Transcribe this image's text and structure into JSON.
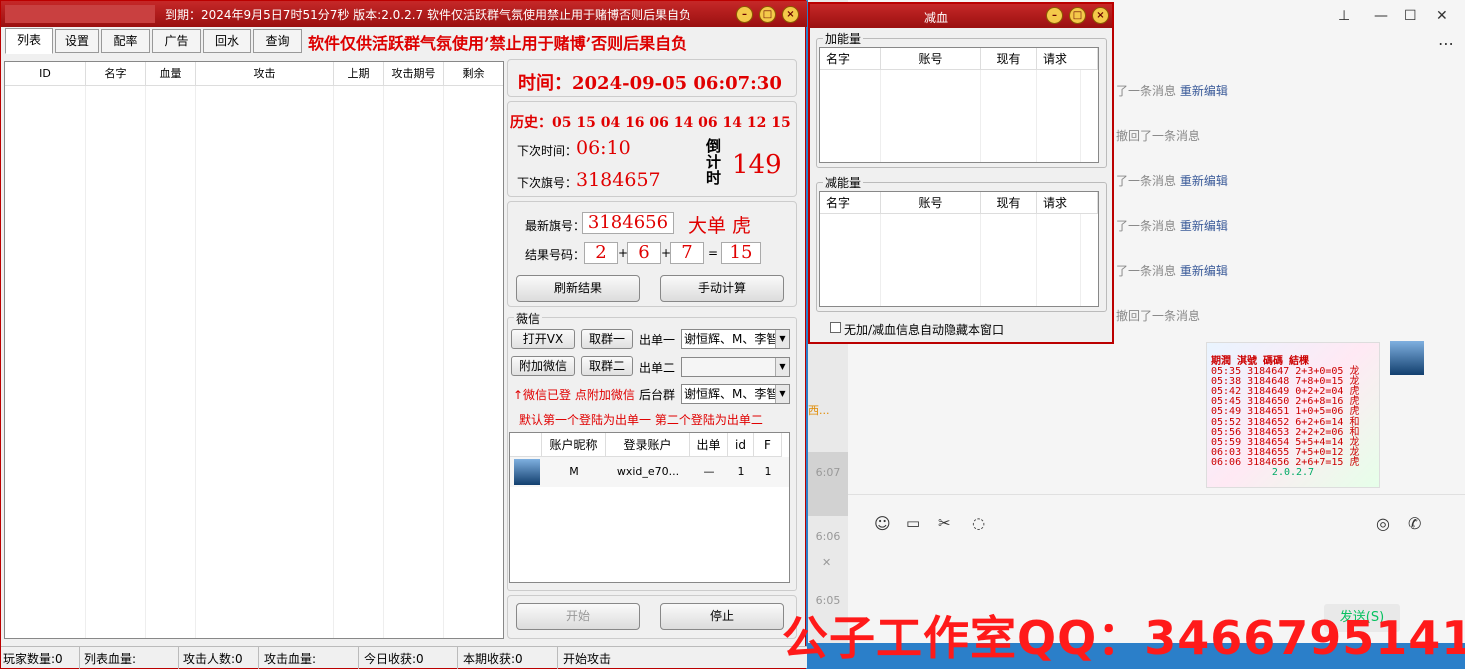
{
  "main": {
    "title": "到期：2024年9月5日7时51分7秒 版本:2.0.2.7 软件仅活跃群气氛使用禁止用于赌博否则后果自负",
    "tabs": [
      "列表",
      "设置",
      "配率",
      "广告",
      "回水",
      "查询"
    ],
    "warning": "软件仅供活跃群气氛使用’禁止用于赌博’否则后果自负",
    "list_columns": [
      "ID",
      "名字",
      "血量",
      "攻击",
      "上期",
      "攻击期号",
      "剩余"
    ],
    "time_label": "时间：",
    "time_value": "2024-09-05 06:07:30",
    "history_label": "历史：",
    "history_values": "05 15 04 16 06 14 06 14 12 15",
    "next_time_label": "下次时间：",
    "next_time_value": "06:10",
    "countdown_label": "倒计时",
    "countdown_value": "149",
    "next_flag_label": "下次旗号：",
    "next_flag_value": "3184657",
    "latest_flag_label": "最新旗号：",
    "latest_flag_value": "3184656",
    "latest_result_text": "大单 虎",
    "result_label": "结果号码：",
    "result_nums": [
      "2",
      "6",
      "7"
    ],
    "result_sum": "15",
    "plus": "+",
    "equals": "=",
    "refresh_button": "刷新结果",
    "manual_button": "手动计算",
    "wechat_group_label": "薇信",
    "open_vx": "打开VX",
    "take_group1": "取群一",
    "out1_label": "出单一",
    "out1_value": "谢恒辉、M、李智",
    "attach_wechat": "附加微信",
    "take_group2": "取群二",
    "out2_label": "出单二",
    "out2_value": "",
    "hint1": "↑微信已登 点附加微信",
    "backstage_label": "后台群",
    "backstage_value": "谢恒辉、M、李智",
    "hint2": "默认第一个登陆为出单一 第二个登陆为出单二",
    "account_columns": [
      "账户昵称",
      "登录账户",
      "出单",
      "id",
      "F"
    ],
    "account_rows": [
      {
        "nick": "M",
        "login": "wxid_e70...",
        "out": "—",
        "id": "1",
        "f": "1"
      }
    ],
    "start_button": "开始",
    "stop_button": "停止",
    "status": {
      "players": "玩家数量:0",
      "list_hp": "列表血量:",
      "attackers": "攻击人数:0",
      "attack_hp": "攻击血量:",
      "today": "今日收获:0",
      "period": "本期收获:0",
      "attack_state": "开始攻击"
    }
  },
  "popup": {
    "title": "减血",
    "add_group": "加能量",
    "sub_group": "减能量",
    "columns": [
      "名字",
      "账号",
      "现有",
      "请求"
    ],
    "auto_hide": "无加/减血信息自动隐藏本窗口"
  },
  "chat": {
    "notes": [
      {
        "text": "了一条消息",
        "link": "重新编辑"
      },
      {
        "text": "撤回了一条消息",
        "link": ""
      },
      {
        "text": "了一条消息",
        "link": "重新编辑"
      },
      {
        "text": "了一条消息",
        "link": "重新编辑"
      },
      {
        "text": "了一条消息",
        "link": "重新编辑"
      },
      {
        "text": "撤回了一条消息",
        "link": ""
      }
    ],
    "side_text": "西...",
    "times": [
      "6:07",
      "6:06",
      "6:05"
    ],
    "image_header": "期潤  淇號   碼碼   結棵",
    "image_rows": [
      "05:35 3184647 2+3+0=05 龙",
      "05:38 3184648 7+8+0=15 龙",
      "05:42 3184649 0+2+2=04 虎",
      "05:45 3184650 2+6+8=16 虎",
      "05:49 3184651 1+0+5=06 虎",
      "05:52 3184652 6+2+6=14 和",
      "05:56 3184653 2+2+2=06 和",
      "05:59 3184654 5+5+4=14 龙",
      "06:03 3184655 7+5+0=12 龙",
      "06:06 3184656 2+6+7=15 虎"
    ],
    "image_footer": "2.0.2.7",
    "send_button": "发送(S)"
  },
  "watermark": "公子工作室QQ：3466795141",
  "colors": {
    "accent_red": "#e00000",
    "title_red": "#b00000",
    "link_blue": "#3a5a99"
  }
}
